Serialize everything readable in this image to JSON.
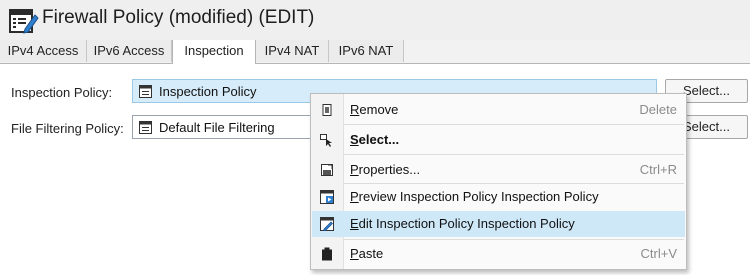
{
  "window": {
    "title": "Firewall Policy (modified) (EDIT)",
    "title_icon": "firewall-policy-edit-icon"
  },
  "tabs": [
    {
      "label": "IPv4 Access",
      "active": false
    },
    {
      "label": "IPv6 Access",
      "active": false
    },
    {
      "label": "Inspection",
      "active": true
    },
    {
      "label": "IPv4 NAT",
      "active": false
    },
    {
      "label": "IPv6 NAT",
      "active": false
    }
  ],
  "form": {
    "inspection_policy": {
      "label": "Inspection Policy:",
      "value": "Inspection Policy",
      "icon": "policy-document-icon",
      "button": "Select..."
    },
    "file_filtering_policy": {
      "label": "File Filtering Policy:",
      "value": "Default File Filtering",
      "icon": "policy-document-icon",
      "button": "Select..."
    }
  },
  "context_menu": {
    "items": [
      {
        "label": "Remove",
        "mnemonic": "R",
        "rest": "emove",
        "shortcut": "Delete",
        "icon": "remove-icon"
      },
      {
        "label": "Select...",
        "mnemonic": "S",
        "rest": "elect...",
        "shortcut": "",
        "icon": "select-cursor-icon",
        "bold": true
      },
      {
        "label": "Properties...",
        "mnemonic": "P",
        "rest": "roperties...",
        "shortcut": "Ctrl+R",
        "icon": "properties-icon"
      },
      {
        "label": "Preview Inspection Policy Inspection Policy",
        "mnemonic": "P",
        "rest": "review Inspection Policy Inspection Policy",
        "shortcut": "",
        "icon": "preview-icon"
      },
      {
        "label": "Edit Inspection Policy Inspection Policy",
        "mnemonic": "E",
        "rest": "dit Inspection Policy Inspection Policy",
        "shortcut": "",
        "icon": "edit-icon",
        "highlighted": true
      },
      {
        "label": "Paste",
        "mnemonic": "P",
        "rest": "aste",
        "shortcut": "Ctrl+V",
        "icon": "paste-icon"
      }
    ]
  },
  "colors": {
    "field_highlight": "#d6ecfa",
    "menu_hover": "#cfe8f8"
  }
}
